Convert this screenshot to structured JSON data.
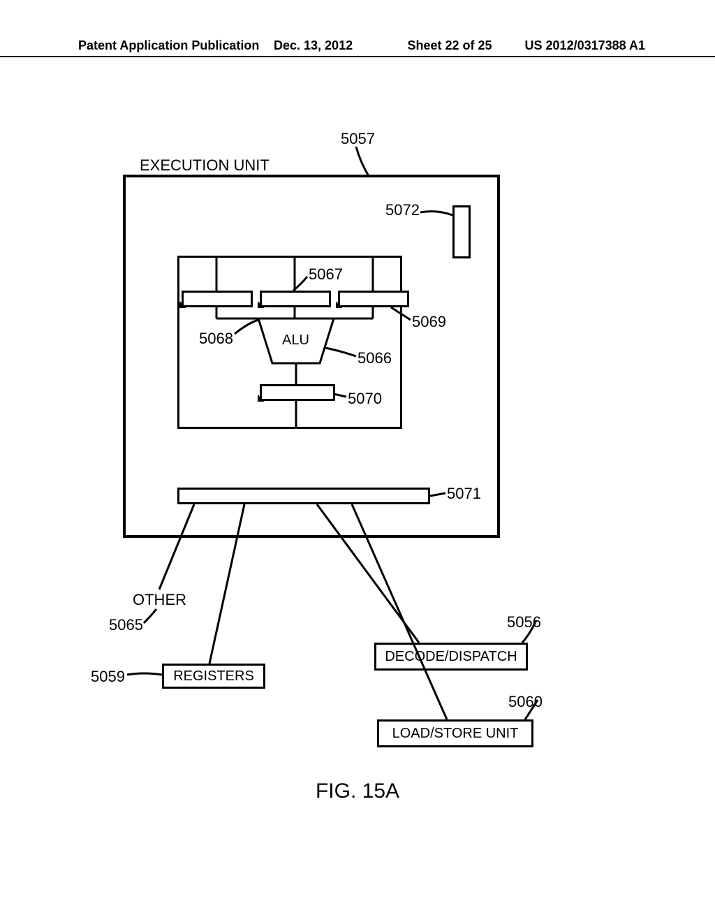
{
  "header": {
    "type": "Patent Application Publication",
    "date": "Dec. 13, 2012",
    "sheet": "Sheet 22 of 25",
    "docno": "US 2012/0317388 A1"
  },
  "labels": {
    "exec_unit": "EXECUTION UNIT",
    "alu": "ALU",
    "other": "OTHER",
    "registers": "REGISTERS",
    "decode": "DECODE/DISPATCH",
    "loadstore": "LOAD/STORE UNIT",
    "figure": "FIG. 15A"
  },
  "refs": {
    "r5057": "5057",
    "r5072": "5072",
    "r5067": "5067",
    "r5068": "5068",
    "r5069": "5069",
    "r5066": "5066",
    "r5070": "5070",
    "r5071": "5071",
    "r5065": "5065",
    "r5059": "5059",
    "r5056": "5056",
    "r5060": "5060"
  }
}
